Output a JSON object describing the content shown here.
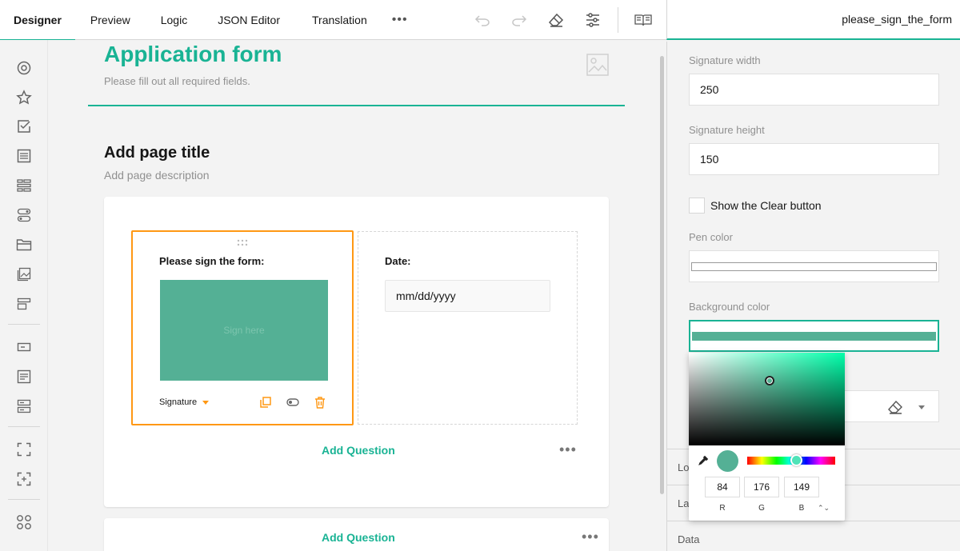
{
  "tabs": [
    {
      "label": "Designer"
    },
    {
      "label": "Preview"
    },
    {
      "label": "Logic"
    },
    {
      "label": "JSON Editor"
    },
    {
      "label": "Translation"
    }
  ],
  "more_label": "•••",
  "right_header": {
    "title": "please_sign_the_form"
  },
  "form": {
    "title": "Application form",
    "description": "Please fill out all required fields."
  },
  "page": {
    "title": "Add page title",
    "description": "Add page description"
  },
  "signature_question": {
    "title": "Please sign the form:",
    "placeholder": "Sign here",
    "type_label": "Signature"
  },
  "date_question": {
    "title": "Date:",
    "placeholder": "mm/dd/yyyy"
  },
  "add_question_label": "Add Question",
  "dots_label": "•••",
  "properties": {
    "sig_width_label": "Signature width",
    "sig_width_value": "250",
    "sig_height_label": "Signature height",
    "sig_height_value": "150",
    "show_clear_label": "Show the Clear button",
    "pen_color_label": "Pen color",
    "pen_color_value": "#ffffff",
    "bg_color_label": "Background color",
    "bg_color_value": "#54b095",
    "section_lo": "Lo",
    "section_la": "La",
    "section_data": "Data"
  },
  "picker": {
    "r": "84",
    "g": "176",
    "b": "149",
    "r_label": "R",
    "g_label": "G",
    "b_label": "B",
    "toggle": "⌃⌄"
  },
  "colors": {
    "accent": "#19b394",
    "selection": "#ff9814",
    "signature_bg": "#54b095"
  }
}
